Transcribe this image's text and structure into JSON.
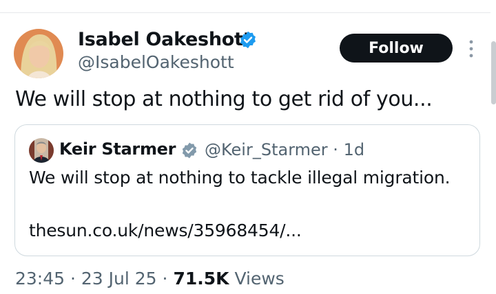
{
  "tweet": {
    "author": {
      "name": "Isabel Oakeshott",
      "handle": "@IsabelOakeshott",
      "verified_icon": "gray-verified-badge-icon"
    },
    "follow_label": "Follow",
    "text": "We will stop at nothing to get rid of you...",
    "quoted": {
      "author": {
        "name": "Keir Starmer",
        "handle": "@Keir_Starmer",
        "verified_icon": "gray-verified-badge-icon"
      },
      "separator": "·",
      "age": "1d",
      "text": "We will stop at nothing to tackle illegal migration.",
      "link": "thesun.co.uk/news/35968454/..."
    },
    "meta": {
      "time": "23:45",
      "date": "23 Jul 25",
      "views_count": "71.5K",
      "views_label": "Views",
      "separator": "·"
    }
  },
  "colors": {
    "text": "#0f1419",
    "secondary": "#536471",
    "button_bg": "#0f1419",
    "badge": "#829aab",
    "border": "#cfd9de"
  }
}
